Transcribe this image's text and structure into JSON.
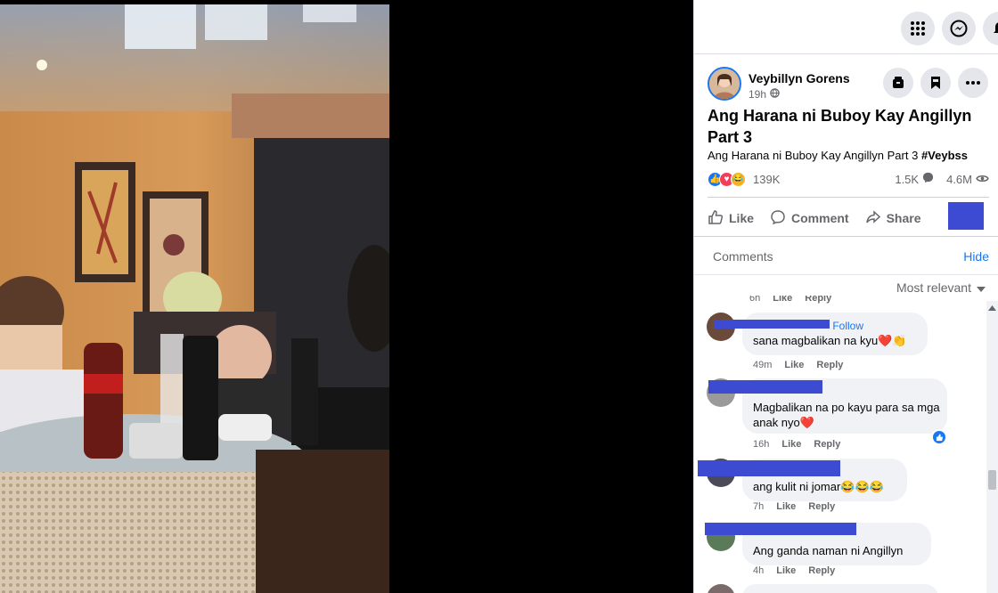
{
  "post": {
    "author": "Veybillyn Gorens",
    "time": "19h",
    "title": "Ang Harana ni Buboy Kay Angillyn Part 3",
    "description": "Ang Harana ni Buboy Kay Angillyn Part 3",
    "hashtag": "#Veybss",
    "reactions_count": "139K",
    "comments_count": "1.5K",
    "views_count": "4.6M"
  },
  "actions": {
    "like": "Like",
    "comment": "Comment",
    "share": "Share"
  },
  "comments_section": {
    "heading": "Comments",
    "hide": "Hide",
    "sort": "Most relevant"
  },
  "partial_meta": {
    "time": "6h",
    "like": "Like",
    "reply": "Reply"
  },
  "comments": [
    {
      "follow": "Follow",
      "text": "sana magbalikan na kyu❤️👏",
      "time": "49m",
      "like": "Like",
      "reply": "Reply"
    },
    {
      "text": "Magbalikan na po kayu para sa mga anak nyo❤️",
      "time": "16h",
      "like": "Like",
      "reply": "Reply"
    },
    {
      "text": "ang kulit ni jomar😂😂😂",
      "time": "7h",
      "like": "Like",
      "reply": "Reply"
    },
    {
      "text": "Ang ganda naman ni Angillyn",
      "time": "4h",
      "like": "Like",
      "reply": "Reply"
    }
  ],
  "icons": {
    "top": [
      "apps-grid-icon",
      "messenger-icon",
      "notifications-bell-icon"
    ],
    "header": [
      "save-icon",
      "bookmark-icon",
      "more-icon"
    ]
  },
  "colors": {
    "accent": "#1877f2",
    "redaction": "#3d4bd3"
  }
}
